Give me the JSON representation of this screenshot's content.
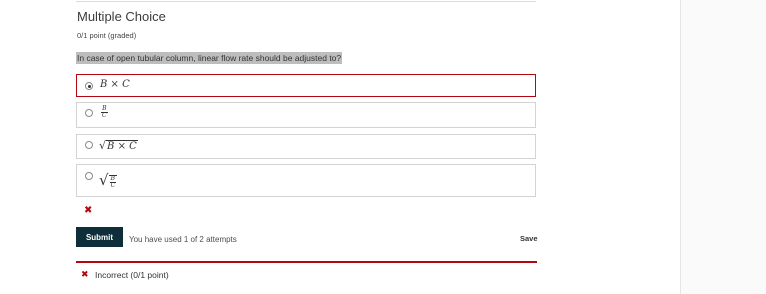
{
  "problem": {
    "title": "Multiple Choice",
    "points": "0/1 point (graded)",
    "question": "In case of open tubular column, linear flow rate should be adjusted to?"
  },
  "choices": [
    {
      "id": "a",
      "selected": true,
      "expr": {
        "left": "B",
        "op": "×",
        "right": "C"
      }
    },
    {
      "id": "b",
      "selected": false,
      "expr": {
        "num": "B",
        "den": "C"
      }
    },
    {
      "id": "c",
      "selected": false,
      "expr": {
        "left": "B",
        "op": "×",
        "right": "C"
      }
    },
    {
      "id": "d",
      "selected": false,
      "expr": {
        "num": "B",
        "den": "C"
      }
    }
  ],
  "status": {
    "error_icon": "✖",
    "error_icon_name": "incorrect-icon"
  },
  "actions": {
    "submit_label": "Submit",
    "attempts_text": "You have used 1 of 2 attempts",
    "save_label": "Save"
  },
  "feedback": {
    "icon": "✖",
    "text": "Incorrect (0/1 point)"
  },
  "colors": {
    "accent": "#b20610",
    "button": "#0e2f3a",
    "question_highlight": "#bdbdbd"
  }
}
